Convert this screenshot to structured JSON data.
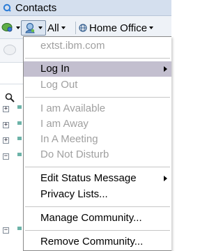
{
  "window": {
    "title": "Contacts",
    "icon": "sametime-q-icon"
  },
  "toolbar": {
    "status_button_icon": "chat-status-icon",
    "presence_button_icon": "presence-person-icon",
    "filter_label": "All",
    "location_label": "Home Office",
    "location_icon": "globe-icon"
  },
  "menu": {
    "server": "extst.ibm.com",
    "log_in": "Log In",
    "log_out": "Log Out",
    "status_available": "I am Available",
    "status_away": "I am Away",
    "status_meeting": "In A Meeting",
    "status_dnd": "Do Not Disturb",
    "edit_status": "Edit Status Message",
    "privacy": "Privacy Lists...",
    "manage_community": "Manage Community...",
    "remove_community": "Remove Community..."
  },
  "colors": {
    "menu_highlight": "#c3bfcf",
    "disabled_text": "#a0a0a0",
    "titlebar_bg": "#d4dfee"
  }
}
